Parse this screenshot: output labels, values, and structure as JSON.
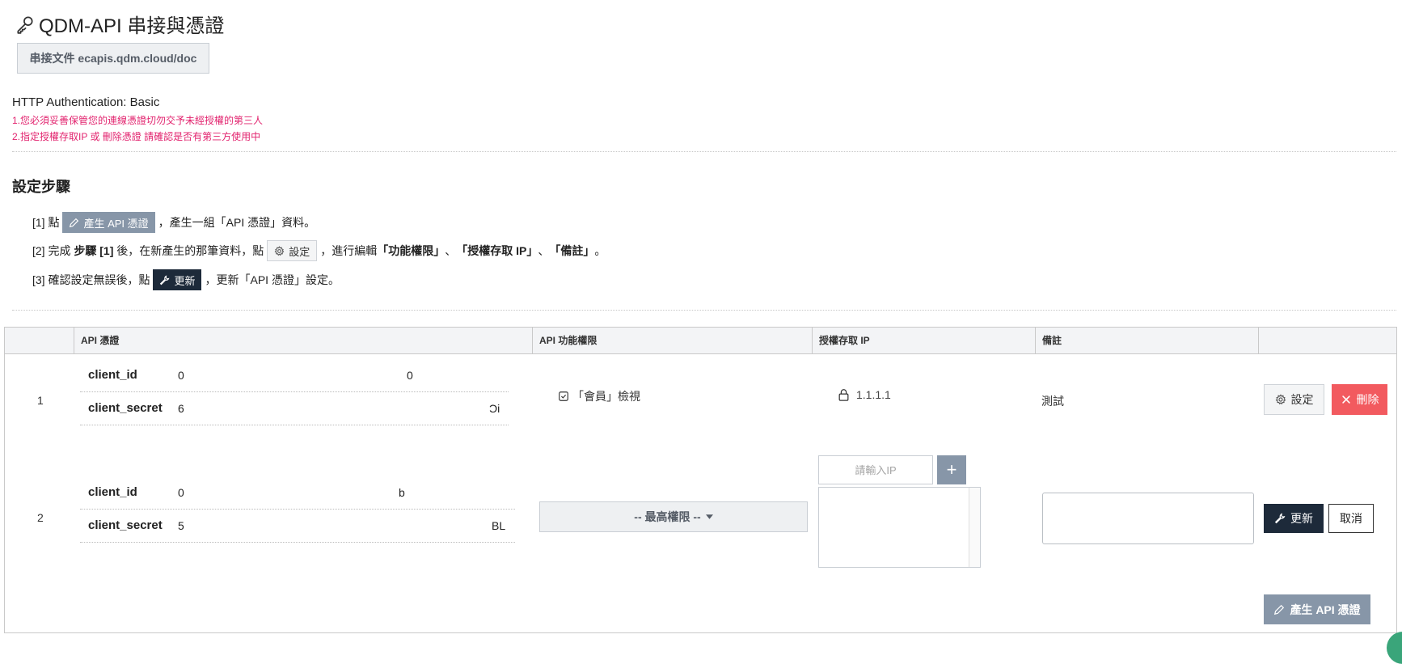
{
  "page": {
    "title": "QDM-API 串接與憑證",
    "doc_button": "串接文件 ecapis.qdm.cloud/doc",
    "auth_label": "HTTP Authentication: Basic",
    "warning_1": "1.您必須妥善保管您的連線憑證切勿交予未經授權的第三人",
    "warning_2": "2.指定授權存取IP 或 刪除憑證 請確認是否有第三方使用中",
    "warning_color": "#e2236e"
  },
  "steps": {
    "title": "設定步驟",
    "s1_prefix": "[1] 點",
    "s1_chip": "產生 API 憑證",
    "s1_suffix": "，產生一組「API 憑證」資料。",
    "s2_prefix": "[2] 完成 ",
    "s2_bold": "步驟 [1]",
    "s2_mid": " 後，在新產生的那筆資料，點",
    "s2_chip": "設定",
    "s2_after": "，進行編輯",
    "s2_b1": "「功能權限」",
    "s2_sep1": "、",
    "s2_b2": "「授權存取 IP」",
    "s2_sep2": "、",
    "s2_b3": "「備註」",
    "s2_end": "。",
    "s3_prefix": "[3] 確認設定無誤後，點",
    "s3_chip": "更新",
    "s3_suffix": "，更新「API 憑證」設定。"
  },
  "table": {
    "headers": [
      "",
      "API 憑證",
      "API 功能權限",
      "授權存取 IP",
      "備註",
      ""
    ],
    "rows": [
      {
        "num": "1",
        "client_id_label": "client_id",
        "client_id_value": "0",
        "client_id_tail": "0",
        "client_secret_label": "client_secret",
        "client_secret_value": "6",
        "client_secret_tail": "Ͻi",
        "permission": "「會員」檢視",
        "ip": "1.1.1.1",
        "note": "測試",
        "set_button": "設定",
        "delete_button": "刪除"
      },
      {
        "num": "2",
        "client_id_label": "client_id",
        "client_id_value": "0",
        "client_id_tail": "b",
        "client_secret_label": "client_secret",
        "client_secret_value": "5",
        "client_secret_tail": "BL",
        "permission_select": "-- 最高權限 --",
        "ip_placeholder": "請輸入IP",
        "add_ip_button": "+",
        "update_button": "更新",
        "cancel_button": "取消"
      }
    ],
    "generate_button": "產生 API 憑證"
  },
  "colors": {
    "primary_dark": "#1d2a3a",
    "slate": "#8796a8",
    "danger": "#f25a5f"
  }
}
